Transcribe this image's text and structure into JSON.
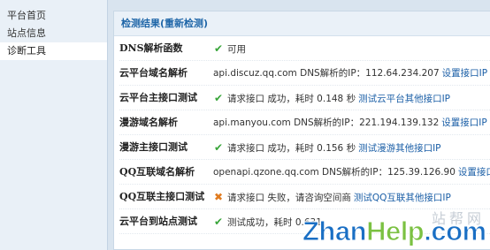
{
  "sidebar": {
    "items": [
      {
        "label": "平台首页",
        "active": false
      },
      {
        "label": "站点信息",
        "active": false
      },
      {
        "label": "诊断工具",
        "active": true
      }
    ]
  },
  "panel": {
    "title": "检测结果(重新检测)"
  },
  "rows": [
    {
      "label": "DNS解析函数",
      "status": "ok",
      "text": "可用",
      "link": ""
    },
    {
      "label": "云平台域名解析",
      "status": "",
      "text": "api.discuz.qq.com DNS解析的IP：112.64.234.207",
      "link": "设置接口IP"
    },
    {
      "label": "云平台主接口测试",
      "status": "ok",
      "text": "请求接口 成功，耗时 0.148 秒",
      "link": "测试云平台其他接口IP"
    },
    {
      "label": "漫游域名解析",
      "status": "",
      "text": "api.manyou.com DNS解析的IP：221.194.139.132",
      "link": "设置接口IP"
    },
    {
      "label": "漫游主接口测试",
      "status": "ok",
      "text": "请求接口 成功，耗时 0.156 秒",
      "link": "测试漫游其他接口IP"
    },
    {
      "label": "QQ互联域名解析",
      "status": "",
      "text": "openapi.qzone.qq.com DNS解析的IP：125.39.126.90",
      "link": "设置接口IP"
    },
    {
      "label": "QQ互联主接口测试",
      "status": "fail",
      "text": "请求接口 失败，请咨询空间商",
      "link": "测试QQ互联其他接口IP"
    },
    {
      "label": "云平台到站点测试",
      "status": "ok",
      "text": "测试成功，耗时 0.631",
      "link": ""
    }
  ],
  "icons": {
    "ok": "check-icon",
    "fail": "cross-icon"
  },
  "colors": {
    "accent": "#1f66a8",
    "ok": "#39a53a",
    "fail": "#e07b1f",
    "link": "#1a5ea6"
  },
  "watermark": {
    "cn": "站帮网",
    "zhan": "Zhan",
    "help": "Help",
    "com": ".com"
  }
}
